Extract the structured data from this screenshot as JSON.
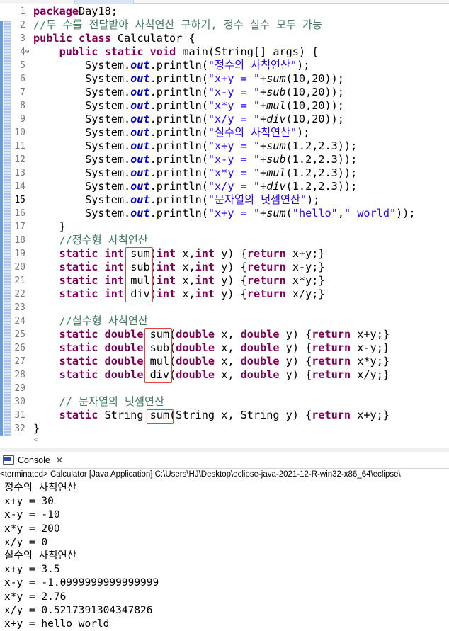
{
  "editor": {
    "current_line": 15,
    "lines": [
      {
        "n": "1",
        "segs": [
          [
            "kw",
            "package"
          ],
          [
            "",
            "Day18;"
          ]
        ]
      },
      {
        "n": "2",
        "segs": [
          [
            "cm",
            "//두 수를 전달받아 사칙연산 구하기, 정수 실수 모두 가능"
          ]
        ]
      },
      {
        "n": "3",
        "segs": [
          [
            "kw",
            "public"
          ],
          [
            "",
            " "
          ],
          [
            "kw",
            "class"
          ],
          [
            "",
            " Calculator {"
          ]
        ]
      },
      {
        "n": "4",
        "fold": "⊖",
        "segs": [
          [
            "",
            "    "
          ],
          [
            "kw",
            "public"
          ],
          [
            "",
            " "
          ],
          [
            "kw",
            "static"
          ],
          [
            "",
            " "
          ],
          [
            "kw",
            "void"
          ],
          [
            "",
            " main(String[] args) {"
          ]
        ]
      },
      {
        "n": "5",
        "segs": [
          [
            "",
            "        System."
          ],
          [
            "fld",
            "out"
          ],
          [
            "",
            ".println("
          ],
          [
            "str",
            "\"정수의 사칙연산\""
          ],
          [
            "",
            ");"
          ]
        ]
      },
      {
        "n": "6",
        "segs": [
          [
            "",
            "        System."
          ],
          [
            "fld",
            "out"
          ],
          [
            "",
            ".println("
          ],
          [
            "str",
            "\"x+y = \""
          ],
          [
            "",
            "+"
          ],
          [
            "sm",
            "sum"
          ],
          [
            "",
            "(10,20));"
          ]
        ]
      },
      {
        "n": "7",
        "segs": [
          [
            "",
            "        System."
          ],
          [
            "fld",
            "out"
          ],
          [
            "",
            ".println("
          ],
          [
            "str",
            "\"x-y = \""
          ],
          [
            "",
            "+"
          ],
          [
            "sm",
            "sub"
          ],
          [
            "",
            "(10,20));"
          ]
        ]
      },
      {
        "n": "8",
        "segs": [
          [
            "",
            "        System."
          ],
          [
            "fld",
            "out"
          ],
          [
            "",
            ".println("
          ],
          [
            "str",
            "\"x*y = \""
          ],
          [
            "",
            "+"
          ],
          [
            "sm",
            "mul"
          ],
          [
            "",
            "(10,20));"
          ]
        ]
      },
      {
        "n": "9",
        "segs": [
          [
            "",
            "        System."
          ],
          [
            "fld",
            "out"
          ],
          [
            "",
            ".println("
          ],
          [
            "str",
            "\"x/y = \""
          ],
          [
            "",
            "+"
          ],
          [
            "sm",
            "div"
          ],
          [
            "",
            "(10,20));"
          ]
        ]
      },
      {
        "n": "10",
        "segs": [
          [
            "",
            "        System."
          ],
          [
            "fld",
            "out"
          ],
          [
            "",
            ".println("
          ],
          [
            "str",
            "\"실수의 사칙연산\""
          ],
          [
            "",
            ");"
          ]
        ]
      },
      {
        "n": "11",
        "segs": [
          [
            "",
            "        System."
          ],
          [
            "fld",
            "out"
          ],
          [
            "",
            ".println("
          ],
          [
            "str",
            "\"x+y = \""
          ],
          [
            "",
            "+"
          ],
          [
            "sm",
            "sum"
          ],
          [
            "",
            "(1.2,2.3));"
          ]
        ]
      },
      {
        "n": "12",
        "segs": [
          [
            "",
            "        System."
          ],
          [
            "fld",
            "out"
          ],
          [
            "",
            ".println("
          ],
          [
            "str",
            "\"x-y = \""
          ],
          [
            "",
            "+"
          ],
          [
            "sm",
            "sub"
          ],
          [
            "",
            "(1.2,2.3));"
          ]
        ]
      },
      {
        "n": "13",
        "segs": [
          [
            "",
            "        System."
          ],
          [
            "fld",
            "out"
          ],
          [
            "",
            ".println("
          ],
          [
            "str",
            "\"x*y = \""
          ],
          [
            "",
            "+"
          ],
          [
            "sm",
            "mul"
          ],
          [
            "",
            "(1.2,2.3));"
          ]
        ]
      },
      {
        "n": "14",
        "segs": [
          [
            "",
            "        System."
          ],
          [
            "fld",
            "out"
          ],
          [
            "",
            ".println("
          ],
          [
            "str",
            "\"x/y = \""
          ],
          [
            "",
            "+"
          ],
          [
            "sm",
            "div"
          ],
          [
            "",
            "(1.2,2.3));"
          ]
        ]
      },
      {
        "n": "15",
        "segs": [
          [
            "",
            "        System."
          ],
          [
            "fld",
            "out"
          ],
          [
            "",
            ".println("
          ],
          [
            "str",
            "\"문자열의 덧셈연산\""
          ],
          [
            "",
            ");"
          ]
        ]
      },
      {
        "n": "16",
        "segs": [
          [
            "",
            "        System."
          ],
          [
            "fld",
            "out"
          ],
          [
            "",
            ".println("
          ],
          [
            "str",
            "\"x+y = \""
          ],
          [
            "",
            "+"
          ],
          [
            "sm",
            "sum"
          ],
          [
            "",
            "("
          ],
          [
            "str",
            "\"hello\""
          ],
          [
            "",
            ","
          ],
          [
            "str",
            "\" world\""
          ],
          [
            "",
            "));"
          ]
        ]
      },
      {
        "n": "17",
        "segs": [
          [
            "",
            "    }"
          ]
        ]
      },
      {
        "n": "18",
        "segs": [
          [
            "",
            "    "
          ],
          [
            "cm",
            "//정수형 사칙연산"
          ]
        ]
      },
      {
        "n": "19",
        "segs": [
          [
            "",
            "    "
          ],
          [
            "kw",
            "static"
          ],
          [
            "",
            " "
          ],
          [
            "kw",
            "int"
          ],
          [
            "",
            " sum("
          ],
          [
            "kw",
            "int"
          ],
          [
            "",
            " x,"
          ],
          [
            "kw",
            "int"
          ],
          [
            "",
            " y) {"
          ],
          [
            "kw",
            "return"
          ],
          [
            "",
            " x+y;}"
          ]
        ]
      },
      {
        "n": "20",
        "segs": [
          [
            "",
            "    "
          ],
          [
            "kw",
            "static"
          ],
          [
            "",
            " "
          ],
          [
            "kw",
            "int"
          ],
          [
            "",
            " sub("
          ],
          [
            "kw",
            "int"
          ],
          [
            "",
            " x,"
          ],
          [
            "kw",
            "int"
          ],
          [
            "",
            " y) {"
          ],
          [
            "kw",
            "return"
          ],
          [
            "",
            " x-y;}"
          ]
        ]
      },
      {
        "n": "21",
        "segs": [
          [
            "",
            "    "
          ],
          [
            "kw",
            "static"
          ],
          [
            "",
            " "
          ],
          [
            "kw",
            "int"
          ],
          [
            "",
            " mul("
          ],
          [
            "kw",
            "int"
          ],
          [
            "",
            " x,"
          ],
          [
            "kw",
            "int"
          ],
          [
            "",
            " y) {"
          ],
          [
            "kw",
            "return"
          ],
          [
            "",
            " x*y;}"
          ]
        ]
      },
      {
        "n": "22",
        "segs": [
          [
            "",
            "    "
          ],
          [
            "kw",
            "static"
          ],
          [
            "",
            " "
          ],
          [
            "kw",
            "int"
          ],
          [
            "",
            " div("
          ],
          [
            "kw",
            "int"
          ],
          [
            "",
            " x,"
          ],
          [
            "kw",
            "int"
          ],
          [
            "",
            " y) {"
          ],
          [
            "kw",
            "return"
          ],
          [
            "",
            " x/y;}"
          ]
        ]
      },
      {
        "n": "23",
        "segs": []
      },
      {
        "n": "24",
        "segs": [
          [
            "",
            "    "
          ],
          [
            "cm",
            "//실수형 사칙연산"
          ]
        ]
      },
      {
        "n": "25",
        "segs": [
          [
            "",
            "    "
          ],
          [
            "kw",
            "static"
          ],
          [
            "",
            " "
          ],
          [
            "kw",
            "double"
          ],
          [
            "",
            " sum("
          ],
          [
            "kw",
            "double"
          ],
          [
            "",
            " x, "
          ],
          [
            "kw",
            "double"
          ],
          [
            "",
            " y) {"
          ],
          [
            "kw",
            "return"
          ],
          [
            "",
            " x+y;}"
          ]
        ]
      },
      {
        "n": "26",
        "segs": [
          [
            "",
            "    "
          ],
          [
            "kw",
            "static"
          ],
          [
            "",
            " "
          ],
          [
            "kw",
            "double"
          ],
          [
            "",
            " sub("
          ],
          [
            "kw",
            "double"
          ],
          [
            "",
            " x, "
          ],
          [
            "kw",
            "double"
          ],
          [
            "",
            " y) {"
          ],
          [
            "kw",
            "return"
          ],
          [
            "",
            " x-y;}"
          ]
        ]
      },
      {
        "n": "27",
        "segs": [
          [
            "",
            "    "
          ],
          [
            "kw",
            "static"
          ],
          [
            "",
            " "
          ],
          [
            "kw",
            "double"
          ],
          [
            "",
            " mul("
          ],
          [
            "kw",
            "double"
          ],
          [
            "",
            " x, "
          ],
          [
            "kw",
            "double"
          ],
          [
            "",
            " y) {"
          ],
          [
            "kw",
            "return"
          ],
          [
            "",
            " x*y;}"
          ]
        ]
      },
      {
        "n": "28",
        "segs": [
          [
            "",
            "    "
          ],
          [
            "kw",
            "static"
          ],
          [
            "",
            " "
          ],
          [
            "kw",
            "double"
          ],
          [
            "",
            " div("
          ],
          [
            "kw",
            "double"
          ],
          [
            "",
            " x, "
          ],
          [
            "kw",
            "double"
          ],
          [
            "",
            " y) {"
          ],
          [
            "kw",
            "return"
          ],
          [
            "",
            " x/y;}"
          ]
        ]
      },
      {
        "n": "29",
        "segs": []
      },
      {
        "n": "30",
        "segs": [
          [
            "",
            "    "
          ],
          [
            "cm",
            "// 문자열의 덧셈연산"
          ]
        ]
      },
      {
        "n": "31",
        "segs": [
          [
            "",
            "    "
          ],
          [
            "kw",
            "static"
          ],
          [
            "",
            " String sum(String x, String y) {"
          ],
          [
            "kw",
            "return"
          ],
          [
            "",
            " x+y;}"
          ]
        ]
      },
      {
        "n": "32",
        "segs": [
          [
            "",
            "}"
          ]
        ]
      }
    ]
  },
  "console": {
    "tab_label": "Console",
    "tab_icon": "console-icon",
    "close_icon": "close-icon",
    "status": "<terminated> Calculator [Java Application] C:\\Users\\HJ\\Desktop\\eclipse-java-2021-12-R-win32-x86_64\\eclipse\\",
    "output": [
      "정수의 사칙연산",
      "x+y = 30",
      "x-y = -10",
      "x*y = 200",
      "x/y = 0",
      "실수의 사칙연산",
      "x+y = 3.5",
      "x-y = -1.0999999999999999",
      "x*y = 2.76",
      "x/y = 0.5217391304347826",
      "x+y = hello world"
    ]
  },
  "colors": {
    "keyword": "#7f0055",
    "string": "#2a00ff",
    "comment": "#3f7f5f",
    "field": "#0000c0",
    "highlight_box": "#e0453c"
  }
}
